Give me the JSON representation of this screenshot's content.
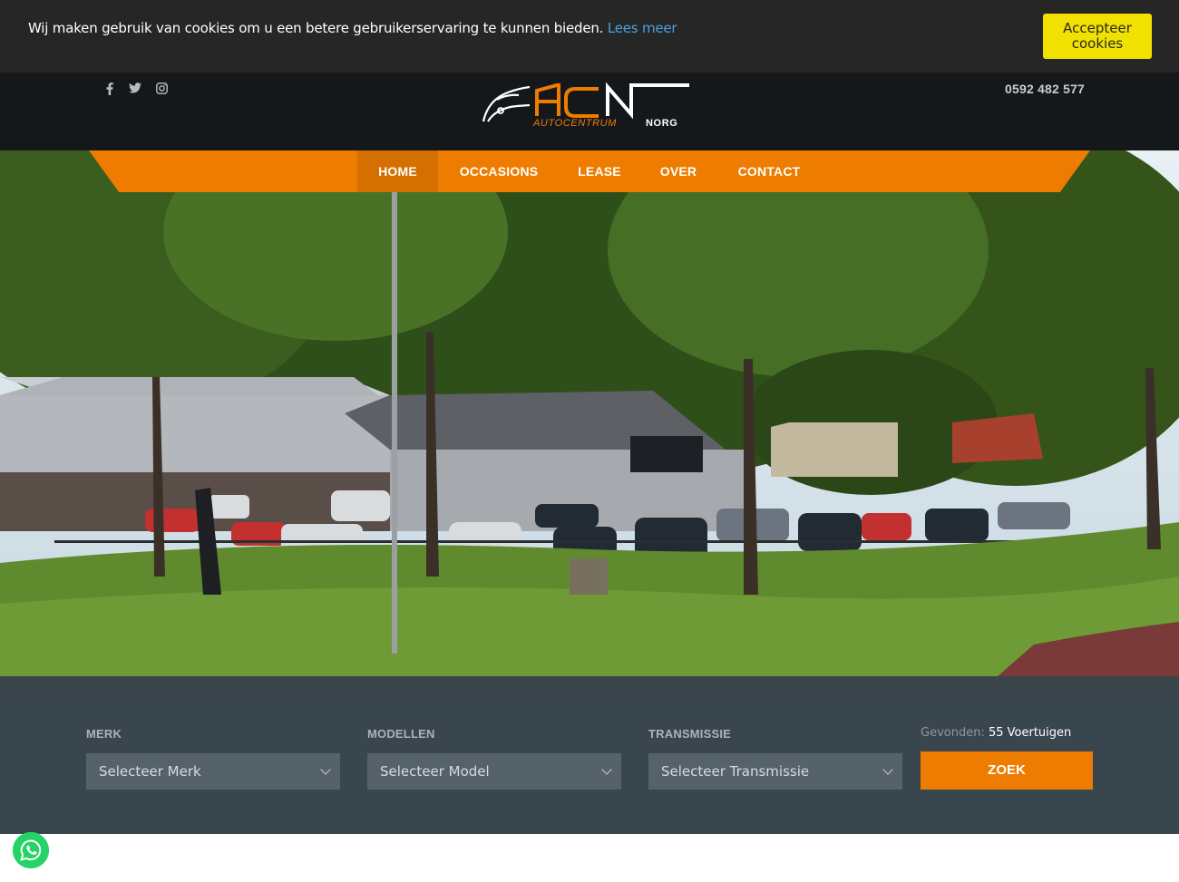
{
  "cookie": {
    "message": "Wij maken gebruik van cookies om u een betere gebruikerservaring te kunnen bieden.",
    "link": "Lees meer",
    "accept_line1": "Accepteer",
    "accept_line2": "cookies"
  },
  "header": {
    "social": [
      {
        "name": "facebook",
        "glyph": "f"
      },
      {
        "name": "twitter",
        "glyph": "🐦"
      },
      {
        "name": "instagram",
        "glyph": "◎"
      }
    ],
    "phone": "0592 482 577",
    "logo": {
      "main": "ACN",
      "sub1": "AUTOCENTRUM",
      "sub2": "NORG"
    }
  },
  "nav": {
    "items": [
      {
        "label": "HOME",
        "active": true
      },
      {
        "label": "OCCASIONS",
        "active": false
      },
      {
        "label": "LEASE",
        "active": false
      },
      {
        "label": "OVER",
        "active": false
      },
      {
        "label": "CONTACT",
        "active": false
      }
    ]
  },
  "search": {
    "merk_label": "MERK",
    "merk_placeholder": "Selecteer Merk",
    "modellen_label": "MODELLEN",
    "modellen_placeholder": "Selecteer Model",
    "transmissie_label": "TRANSMISSIE",
    "transmissie_placeholder": "Selecteer Transmissie",
    "found_label": "Gevonden:",
    "found_count": "55 Voertuigen",
    "submit": "ZOEK"
  },
  "colors": {
    "accent": "#ee7c00",
    "cookie_button": "#f1e100",
    "header_bg": "#15181b",
    "search_bg": "#3a464e"
  },
  "icons": {
    "facebook": "facebook-icon",
    "twitter": "twitter-icon",
    "instagram": "instagram-icon",
    "whatsapp": "whatsapp-icon"
  }
}
